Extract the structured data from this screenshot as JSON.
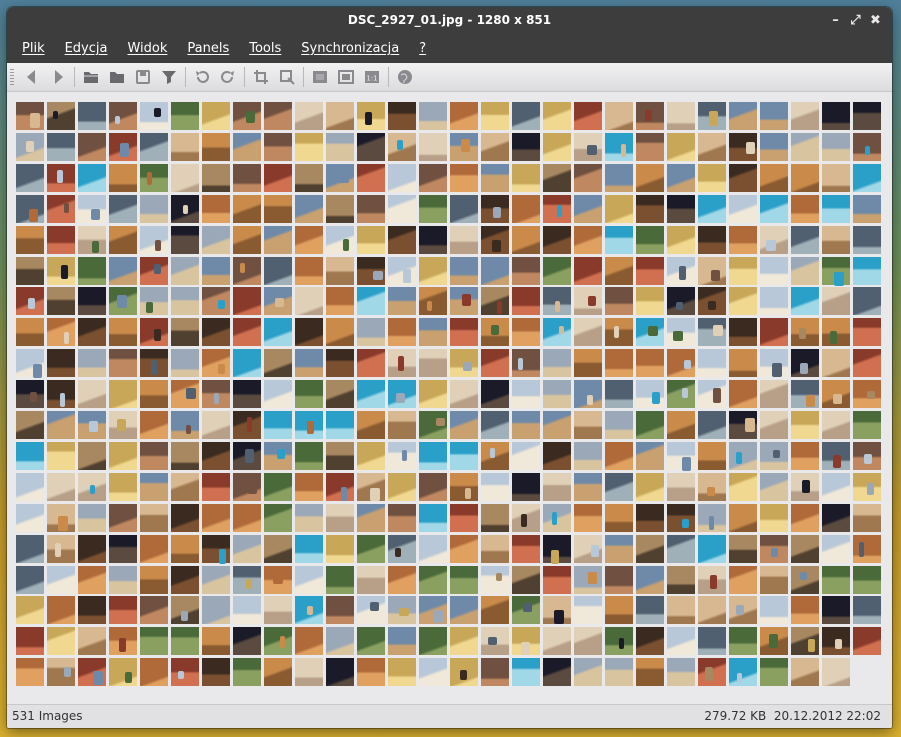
{
  "window": {
    "title": "DSC_2927_01.jpg - 1280 x 851"
  },
  "menu": [
    "Plik",
    "Edycja",
    "Widok",
    "Panels",
    "Tools",
    "Synchronizacja",
    "?"
  ],
  "toolbar": [
    {
      "icon": "back-arrow-icon"
    },
    {
      "icon": "forward-arrow-icon"
    },
    {
      "sep": true
    },
    {
      "icon": "folder-open-icon"
    },
    {
      "icon": "folder-icon"
    },
    {
      "icon": "save-icon"
    },
    {
      "icon": "filter-icon"
    },
    {
      "sep": true
    },
    {
      "icon": "rotate-left-icon"
    },
    {
      "icon": "rotate-right-icon"
    },
    {
      "sep": true
    },
    {
      "icon": "crop-icon"
    },
    {
      "icon": "resize-icon"
    },
    {
      "sep": true
    },
    {
      "icon": "fit-window-icon"
    },
    {
      "icon": "fullscreen-icon"
    },
    {
      "icon": "actual-size-icon"
    },
    {
      "sep": true
    },
    {
      "icon": "globe-icon"
    }
  ],
  "thumbnails": {
    "count": 531
  },
  "status": {
    "images": "531 Images",
    "size": "279.72 KB",
    "date": "20.12.2012 22:02"
  }
}
